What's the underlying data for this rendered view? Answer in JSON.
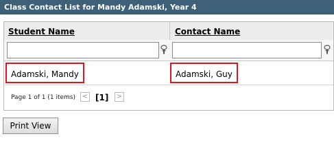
{
  "panel": {
    "title": "Class Contact List for Mandy Adamski, Year 4"
  },
  "grid": {
    "columns": [
      {
        "label": "Student Name"
      },
      {
        "label": "Contact Name"
      }
    ],
    "filters": [
      {
        "value": "",
        "placeholder": ""
      },
      {
        "value": "",
        "placeholder": ""
      }
    ],
    "rows": [
      {
        "student": "Adamski, Mandy",
        "contact": "Adamski, Guy"
      }
    ],
    "pager": {
      "info": "Page 1 of 1 (1 items)",
      "prev_symbol": "<",
      "current_page": "[1]",
      "next_symbol": ">"
    }
  },
  "actions": {
    "print_view_label": "Print View"
  },
  "icons": {
    "filter": "filter-icon",
    "prev": "chevron-left-icon",
    "next": "chevron-right-icon"
  },
  "colors": {
    "title_bar_bg": "#3e6078",
    "highlight": "#e0141c"
  }
}
